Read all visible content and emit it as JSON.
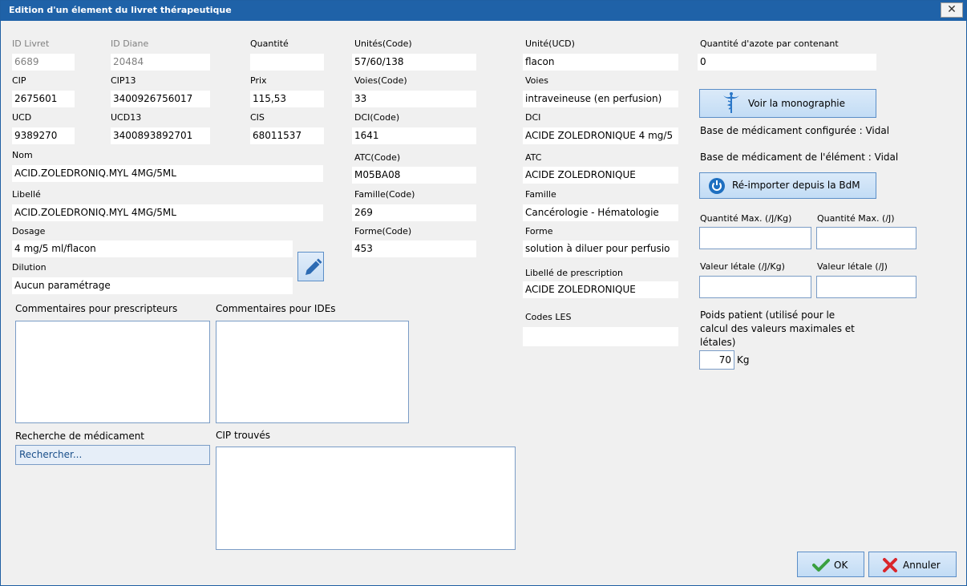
{
  "window": {
    "title": "Edition d'un élement du livret thérapeutique",
    "close_glyph": "✕"
  },
  "fields": {
    "id_livret": {
      "label": "ID Livret",
      "value": "6689"
    },
    "id_diane": {
      "label": "ID Diane",
      "value": "20484"
    },
    "quantite": {
      "label": "Quantité",
      "value": ""
    },
    "unites_code": {
      "label": "Unités(Code)",
      "value": "57/60/138"
    },
    "unite_ucd": {
      "label": "Unité(UCD)",
      "value": "flacon"
    },
    "qte_azote": {
      "label": "Quantité d'azote par contenant",
      "value": "0"
    },
    "cip": {
      "label": "CIP",
      "value": "2675601"
    },
    "cip13": {
      "label": "CIP13",
      "value": "3400926756017"
    },
    "prix": {
      "label": "Prix",
      "value": "115,53"
    },
    "voies_code": {
      "label": "Voies(Code)",
      "value": "33"
    },
    "voies": {
      "label": "Voies",
      "value": "intraveineuse (en perfusion)"
    },
    "ucd": {
      "label": "UCD",
      "value": "9389270"
    },
    "ucd13": {
      "label": "UCD13",
      "value": "3400893892701"
    },
    "cis": {
      "label": "CIS",
      "value": "68011537"
    },
    "dci_code": {
      "label": "DCI(Code)",
      "value": "1641"
    },
    "dci": {
      "label": "DCI",
      "value": "ACIDE ZOLEDRONIQUE 4 mg/5"
    },
    "nom": {
      "label": "Nom",
      "value": "ACID.ZOLEDRONIQ.MYL 4MG/5ML"
    },
    "atc_code": {
      "label": "ATC(Code)",
      "value": "M05BA08"
    },
    "atc": {
      "label": "ATC",
      "value": "ACIDE ZOLEDRONIQUE"
    },
    "libelle": {
      "label": "Libellé",
      "value": "ACID.ZOLEDRONIQ.MYL 4MG/5ML"
    },
    "famille_code": {
      "label": "Famille(Code)",
      "value": "269"
    },
    "famille": {
      "label": "Famille",
      "value": "Cancérologie - Hématologie"
    },
    "dosage": {
      "label": "Dosage",
      "value": "4 mg/5 ml/flacon"
    },
    "forme_code": {
      "label": "Forme(Code)",
      "value": "453"
    },
    "forme": {
      "label": "Forme",
      "value": "solution à diluer pour perfusio"
    },
    "dilution": {
      "label": "Dilution",
      "value": "Aucun paramétrage"
    },
    "libelle_prescription": {
      "label": "Libellé de prescription",
      "value": "ACIDE ZOLEDRONIQUE"
    },
    "codes_les": {
      "label": "Codes LES",
      "value": ""
    }
  },
  "comments": {
    "prescripteurs_label": "Commentaires pour prescripteurs",
    "ides_label": "Commentaires pour IDEs"
  },
  "search": {
    "label": "Recherche de médicament",
    "placeholder": "Rechercher...",
    "cip_trouves_label": "CIP trouvés"
  },
  "right": {
    "monographie_label": "Voir la monographie",
    "base_configuree": "Base de médicament configurée : Vidal",
    "base_element": "Base de médicament de l'élément : Vidal",
    "reimport_label": "Ré-importer depuis la BdM",
    "qmax_jkg_label": "Quantité Max. (/J/Kg)",
    "qmax_j_label": "Quantité Max. (/J)",
    "vletale_jkg_label": "Valeur létale (/J/Kg)",
    "vletale_j_label": "Valeur létale (/J)",
    "poids_label_1": "Poids patient (utilisé pour le",
    "poids_label_2": "calcul des valeurs maximales et",
    "poids_label_3": "létales)",
    "poids_value": "70",
    "poids_unit": "Kg"
  },
  "footer": {
    "ok_label": "OK",
    "cancel_label": "Annuler"
  },
  "colors": {
    "titlebar": "#1f62a8",
    "ok_check": "#3aa040",
    "cancel_x": "#d9262c",
    "button_face": "#c2dcf5"
  }
}
